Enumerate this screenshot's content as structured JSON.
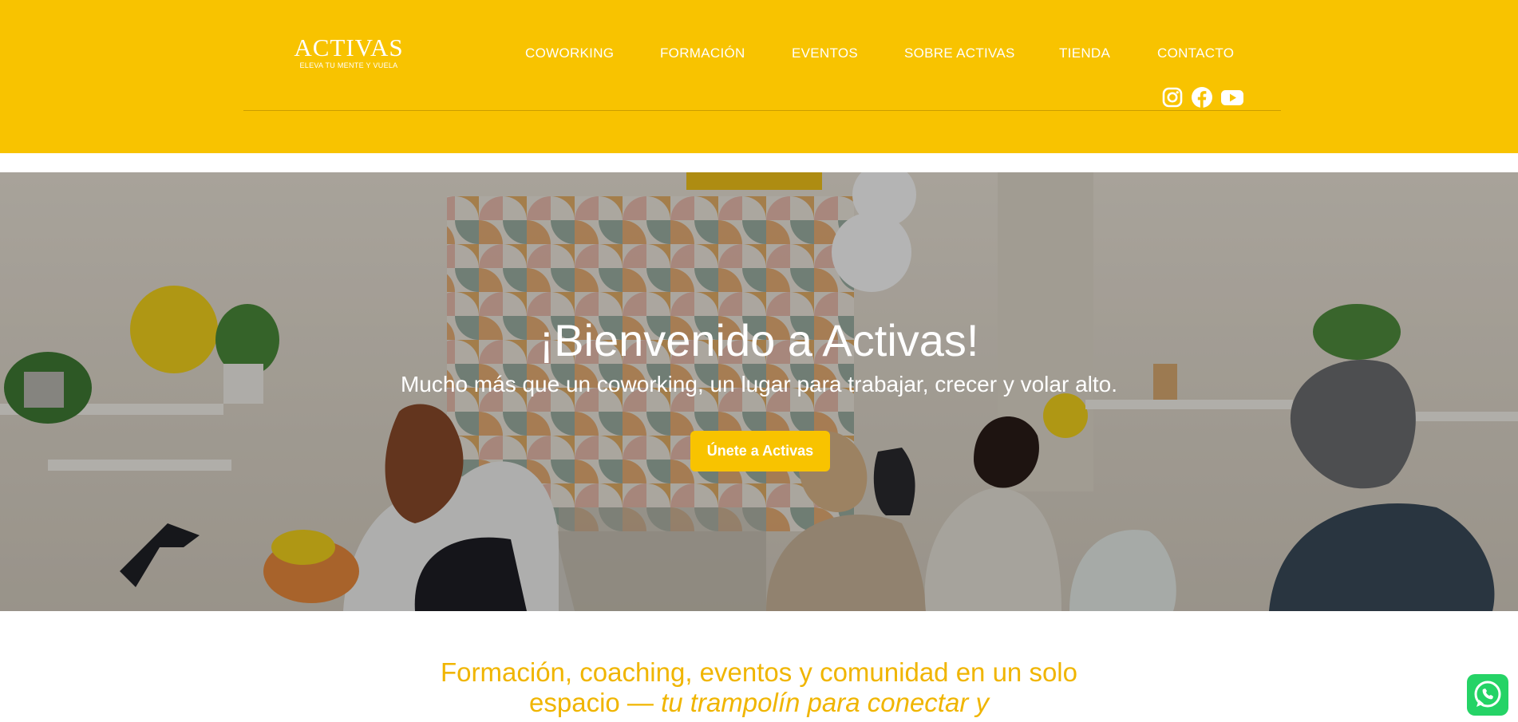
{
  "brand": {
    "name": "ACTIVAS",
    "tagline": "ELEVA TU MENTE Y VUELA"
  },
  "nav": {
    "items": [
      {
        "label": "COWORKING"
      },
      {
        "label": "FORMACIÓN"
      },
      {
        "label": "EVENTOS"
      },
      {
        "label": "SOBRE ACTIVAS"
      },
      {
        "label": "TIENDA"
      },
      {
        "label": "CONTACTO"
      }
    ]
  },
  "social": {
    "icons": [
      "instagram-icon",
      "facebook-icon",
      "youtube-icon"
    ]
  },
  "hero": {
    "title": "¡Bienvenido a Activas!",
    "subtitle": "Mucho más que un coworking, un lugar para trabajar, crecer y volar alto.",
    "cta_label": "Únete a Activas"
  },
  "intro": {
    "line1": "Formación, coaching, eventos y comunidad en un solo",
    "line2_plain": "espacio — ",
    "line2_italic": "tu trampolín para conectar y"
  },
  "colors": {
    "accent": "#f8c300",
    "intro_text": "#f0b500",
    "whatsapp": "#25d366"
  }
}
